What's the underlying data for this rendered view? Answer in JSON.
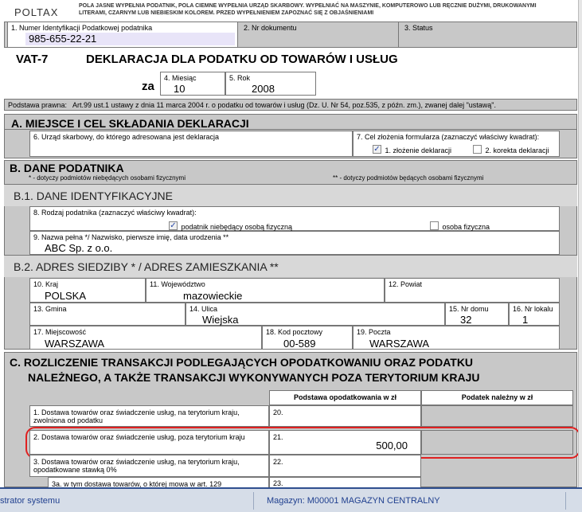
{
  "header": {
    "logo": "POLTAX",
    "instructions": "POLA JASNE WYPEŁNIA PODATNIK, POLA CIEMNE WYPEŁNIA URZĄD SKARBOWY. WYPEŁNIAĆ NA MASZYNIE, KOMPUTEROWO LUB RĘCZNIE DUŻYMI, DRUKOWANYMI LITERAMI, CZARNYM LUB NIEBIESKIM KOLOREM. PRZED WYPEŁNIENIEM ZAPOZNAĆ SIĘ Z OBJAŚNIENIAMI",
    "nip_label": "1. Numer Identyfikacji Podatkowej podatnika",
    "nip_value": "985-655-22-21",
    "doc_no_label": "2. Nr dokumentu",
    "status_label": "3. Status"
  },
  "title": {
    "form_code": "VAT-7",
    "name": "DEKLARACJA DLA PODATKU OD TOWARÓW I USŁUG",
    "za": "za",
    "month_label": "4. Miesiąc",
    "month_value": "10",
    "year_label": "5. Rok",
    "year_value": "2008"
  },
  "legal_basis": {
    "label": "Podstawa prawna:",
    "text": "Art.99 ust.1 ustawy z dnia 11 marca 2004 r. o podatku od towarów i usług (Dz. U. Nr 54, poz.535, z późn. zm.), zwanej dalej \"ustawą\"."
  },
  "section_a": {
    "title": "A. MIEJSCE I CEL SKŁADANIA DEKLARACJI",
    "office_label": "6. Urząd skarbowy, do którego adresowana jest deklaracja",
    "purpose_label": "7. Cel złożenia formularza (zaznaczyć właściwy kwadrat):",
    "opt1": "1. złożenie deklaracji",
    "opt2": "2. korekta deklaracji"
  },
  "section_b": {
    "title": "B. DANE PODATNIKA",
    "note1": "* - dotyczy podmiotów niebędących osobami fizycznymi",
    "note2": "** - dotyczy podmiotów będących osobami fizycznymi",
    "b1_title": "B.1. DANE IDENTYFIKACYJNE",
    "type_label": "8. Rodzaj podatnika (zaznaczyć właściwy kwadrat):",
    "type_opt1": "podatnik niebędący osobą fizyczną",
    "type_opt2": "osoba fizyczna",
    "name_label": "9. Nazwa pełna */ Nazwisko, pierwsze imię, data urodzenia **",
    "name_value": "ABC Sp. z o.o.",
    "b2_title": "B.2. ADRES SIEDZIBY * / ADRES ZAMIESZKANIA **",
    "country_label": "10. Kraj",
    "country_value": "POLSKA",
    "province_label": "11. Województwo",
    "province_value": "mazowieckie",
    "county_label": "12. Powiat",
    "commune_label": "13. Gmina",
    "street_label": "14. Ulica",
    "street_value": "Wiejska",
    "house_label": "15. Nr domu",
    "house_value": "32",
    "flat_label": "16. Nr lokalu",
    "flat_value": "1",
    "city_label": "17. Miejscowość",
    "city_value": "WARSZAWA",
    "postcode_label": "18. Kod pocztowy",
    "postcode_value": "00-589",
    "post_label": "19. Poczta",
    "post_value": "WARSZAWA"
  },
  "section_c": {
    "title_line1": "C. ROZLICZENIE TRANSAKCJI PODLEGAJĄCYCH OPODATKOWANIU ORAZ PODATKU",
    "title_line2": "NALEŻNEGO, A TAKŻE TRANSAKCJI WYKONYWANYCH POZA TERYTORIUM KRAJU",
    "col_base": "Podstawa opodatkowania w zł",
    "col_tax": "Podatek należny w zł",
    "rows": [
      {
        "label": "1. Dostawa towarów oraz świadczenie usług, na terytorium kraju, zwolniona od podatku",
        "num": "20.",
        "value": ""
      },
      {
        "label": "2. Dostawa towarów oraz świadczenie usług, poza terytorium kraju",
        "num": "21.",
        "value": "500,00"
      },
      {
        "label": "3. Dostawa towarów oraz świadczenie usług, na terytorium kraju, opodatkowane stawką 0%",
        "num": "22.",
        "value": ""
      },
      {
        "label": "3a. w tym dostawa towarów, o której mowa w art. 129",
        "num": "23.",
        "value": ""
      }
    ]
  },
  "statusbar": {
    "user": "strator systemu",
    "warehouse": "Magazyn: M00001 MAGAZYN CENTRALNY"
  }
}
